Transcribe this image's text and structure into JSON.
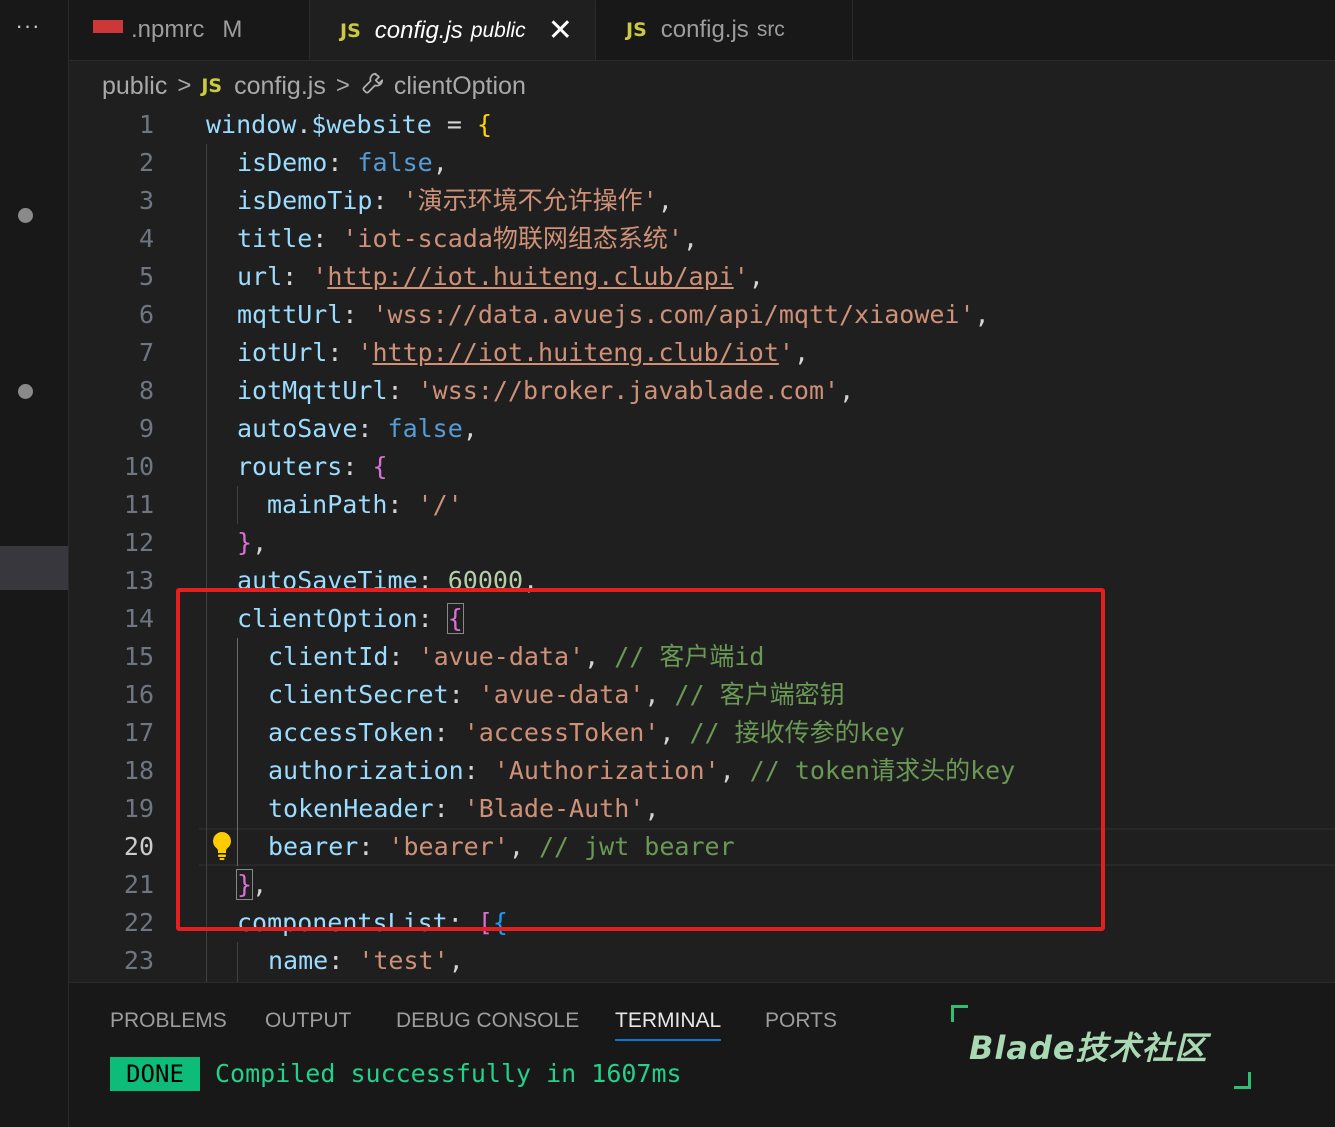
{
  "activity_bar": {
    "more_label": "···"
  },
  "tabs": [
    {
      "name": ".npmrc",
      "badge": "M"
    },
    {
      "name": "config.js",
      "desc": "public",
      "close": "✕",
      "icon_text": "JS"
    },
    {
      "name": "config.js",
      "desc": "src",
      "icon_text": "JS"
    }
  ],
  "breadcrumb": {
    "folder": "public",
    "file_icon": "JS",
    "file": "config.js",
    "symbol": "clientOption",
    "sep": ">"
  },
  "editor": {
    "current_line": 20,
    "line_numbers": [
      "1",
      "2",
      "3",
      "4",
      "5",
      "6",
      "7",
      "8",
      "9",
      "10",
      "11",
      "12",
      "13",
      "14",
      "15",
      "16",
      "17",
      "18",
      "19",
      "20",
      "21",
      "22",
      "23"
    ],
    "code": {
      "l1": {
        "obj": "window",
        "dot": ".",
        "prop": "$website",
        "eq": " = ",
        "brace": "{"
      },
      "l2": {
        "key": "isDemo",
        "colon": ": ",
        "val": "false",
        "comma": ","
      },
      "l3": {
        "key": "isDemoTip",
        "colon": ": ",
        "val": "'演示环境不允许操作'",
        "comma": ","
      },
      "l4": {
        "key": "title",
        "colon": ": ",
        "val": "'iot-scada物联网组态系统'",
        "comma": ","
      },
      "l5": {
        "key": "url",
        "colon": ": ",
        "q1": "'",
        "url": "http://iot.huiteng.club/api",
        "q2": "'",
        "comma": ","
      },
      "l6": {
        "key": "mqttUrl",
        "colon": ": ",
        "val": "'wss://data.avuejs.com/api/mqtt/xiaowei'",
        "comma": ","
      },
      "l7": {
        "key": "iotUrl",
        "colon": ": ",
        "q1": "'",
        "url": "http://iot.huiteng.club/iot",
        "q2": "'",
        "comma": ","
      },
      "l8": {
        "key": "iotMqttUrl",
        "colon": ": ",
        "val": "'wss://broker.javablade.com'",
        "comma": ","
      },
      "l9": {
        "key": "autoSave",
        "colon": ": ",
        "val": "false",
        "comma": ","
      },
      "l10": {
        "key": "routers",
        "colon": ": ",
        "brace": "{"
      },
      "l11": {
        "key": "mainPath",
        "colon": ": ",
        "val": "'/'"
      },
      "l12": {
        "brace": "}",
        "comma": ","
      },
      "l13": {
        "key": "autoSaveTime",
        "colon": ": ",
        "val": "60000",
        "comma": ","
      },
      "l14": {
        "key": "clientOption",
        "colon": ": ",
        "brace": "{"
      },
      "l15": {
        "key": "clientId",
        "colon": ": ",
        "val": "'avue-data'",
        "comma": ", ",
        "comment": "// 客户端id"
      },
      "l16": {
        "key": "clientSecret",
        "colon": ": ",
        "val": "'avue-data'",
        "comma": ", ",
        "comment": "// 客户端密钥"
      },
      "l17": {
        "key": "accessToken",
        "colon": ": ",
        "val": "'accessToken'",
        "comma": ", ",
        "comment": "// 接收传参的key"
      },
      "l18": {
        "key": "authorization",
        "colon": ": ",
        "val": "'Authorization'",
        "comma": ", ",
        "comment": "// token请求头的key"
      },
      "l19": {
        "key": "tokenHeader",
        "colon": ": ",
        "val": "'Blade-Auth'",
        "comma": ","
      },
      "l20": {
        "key": "bearer",
        "colon": ": ",
        "val": "'bearer'",
        "comma": ", ",
        "comment": "// jwt bearer"
      },
      "l21": {
        "brace": "}",
        "comma": ","
      },
      "l22": {
        "key": "componentsList",
        "colon": ": ",
        "bracket": "[",
        "brace": "{"
      },
      "l23": {
        "key": "name",
        "colon": ": ",
        "val": "'test'",
        "comma": ","
      }
    }
  },
  "panel": {
    "tabs": [
      "PROBLEMS",
      "OUTPUT",
      "DEBUG CONSOLE",
      "TERMINAL",
      "PORTS"
    ],
    "active_tab": "TERMINAL",
    "terminal": {
      "badge": "DONE",
      "message": "Compiled successfully in 1607ms"
    }
  },
  "watermark": {
    "text": "Blade技术社区"
  },
  "colors": {
    "accent": "#0078d4",
    "highlight_box": "#e51e1e",
    "done_badge": "#0dbc79",
    "success_text": "#23d18b"
  }
}
